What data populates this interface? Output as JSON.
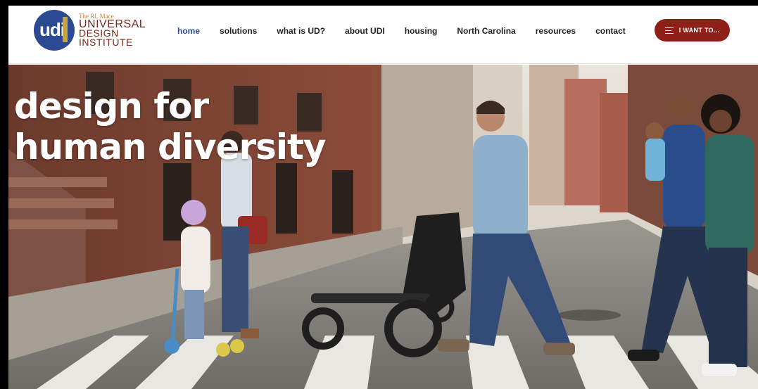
{
  "logo": {
    "mark": "udi",
    "small": "The RL Mace",
    "line1": "UNIVERSAL",
    "line2": "DESIGN",
    "line3": "INSTITUTE",
    "colors": {
      "circle": "#2b4a93",
      "accent": "#c8a53a",
      "text": "#7a2a1e"
    }
  },
  "nav": {
    "items": [
      {
        "label": "home",
        "active": true
      },
      {
        "label": "solutions"
      },
      {
        "label": "what is UD?"
      },
      {
        "label": "about UDI"
      },
      {
        "label": "housing"
      },
      {
        "label": "North Carolina"
      },
      {
        "label": "resources"
      },
      {
        "label": "contact"
      }
    ],
    "active_color": "#2b4a93"
  },
  "cta": {
    "label": "I WANT TO...",
    "icon": "menu-icon",
    "color": "#8e2018"
  },
  "hero": {
    "headline_line1": "design for",
    "headline_line2": "human diversity",
    "image": "family-crossing-city-street-photo"
  }
}
